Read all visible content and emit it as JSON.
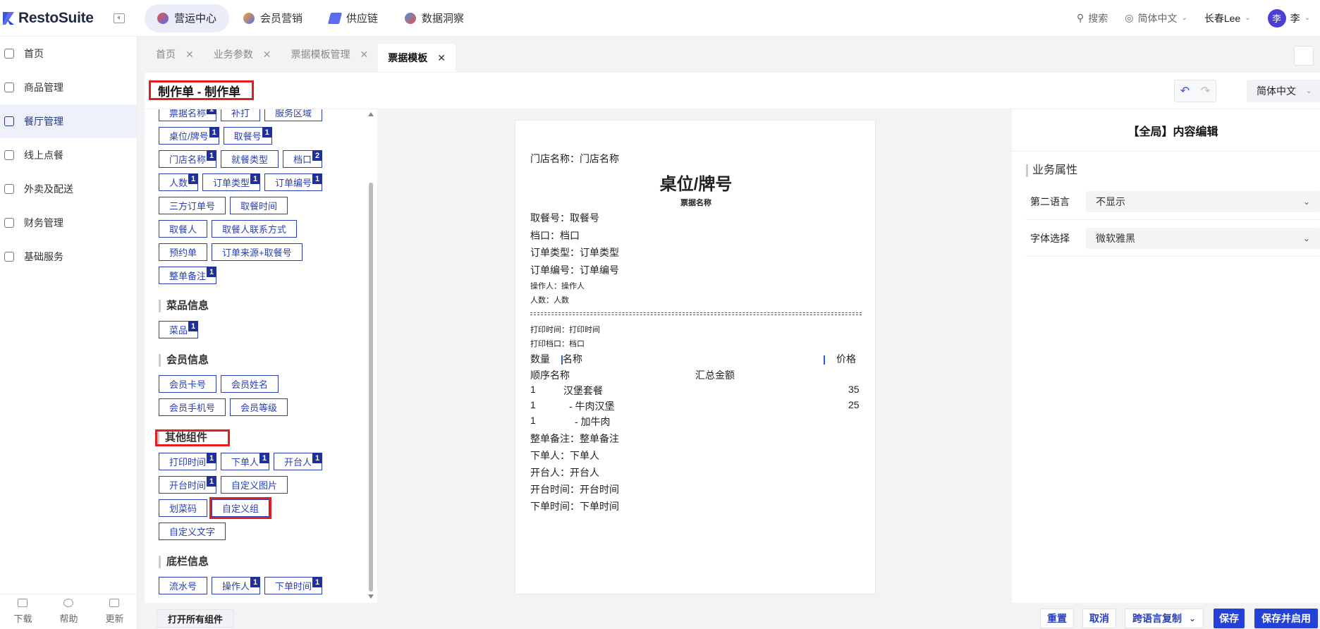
{
  "app": {
    "logo_text": "RestoSuite"
  },
  "nav": [
    {
      "label": "营运中心",
      "color": "#e9573f",
      "active": true
    },
    {
      "label": "会员营销",
      "color": "#f5a623",
      "active": false
    },
    {
      "label": "供应链",
      "color": "#5b6cf0",
      "active": false
    },
    {
      "label": "数据洞察",
      "color": "#4a90e2",
      "active": false
    }
  ],
  "topright": {
    "search": "搜索",
    "language": "简体中文",
    "store": "长春Lee",
    "avatar_char": "李",
    "user": "李"
  },
  "sidebar": {
    "items": [
      {
        "label": "首页"
      },
      {
        "label": "商品管理"
      },
      {
        "label": "餐厅管理",
        "active": true
      },
      {
        "label": "线上点餐"
      },
      {
        "label": "外卖及配送"
      },
      {
        "label": "财务管理"
      },
      {
        "label": "基础服务"
      }
    ],
    "bottom": [
      "下载",
      "帮助",
      "更新"
    ]
  },
  "tabs": [
    {
      "label": "首页"
    },
    {
      "label": "业务参数"
    },
    {
      "label": "票据模板管理"
    },
    {
      "label": "票据模板",
      "active": true
    }
  ],
  "header": {
    "title": "制作单 - 制作单",
    "language": "简体中文"
  },
  "components": {
    "rows_top": [
      [
        {
          "label": "票据名称",
          "badge": "1"
        },
        {
          "label": "补打"
        },
        {
          "label": "服务区域"
        }
      ],
      [
        {
          "label": "桌位/牌号",
          "badge": "1"
        },
        {
          "label": "取餐号",
          "badge": "1"
        }
      ],
      [
        {
          "label": "门店名称",
          "badge": "1"
        },
        {
          "label": "就餐类型"
        },
        {
          "label": "档口",
          "badge": "2"
        }
      ],
      [
        {
          "label": "人数",
          "badge": "1"
        },
        {
          "label": "订单类型",
          "badge": "1"
        },
        {
          "label": "订单编号",
          "badge": "1"
        }
      ],
      [
        {
          "label": "三方订单号"
        },
        {
          "label": "取餐时间"
        }
      ],
      [
        {
          "label": "取餐人"
        },
        {
          "label": "取餐人联系方式"
        }
      ],
      [
        {
          "label": "预约单"
        },
        {
          "label": "订单来源+取餐号"
        }
      ],
      [
        {
          "label": "整单备注",
          "badge": "1"
        }
      ]
    ],
    "dish_title": "菜品信息",
    "dish_rows": [
      [
        {
          "label": "菜品",
          "badge": "1"
        }
      ]
    ],
    "member_title": "会员信息",
    "member_rows": [
      [
        {
          "label": "会员卡号"
        },
        {
          "label": "会员姓名"
        }
      ],
      [
        {
          "label": "会员手机号"
        },
        {
          "label": "会员等级"
        }
      ]
    ],
    "other_title": "其他组件",
    "other_rows": [
      [
        {
          "label": "打印时间",
          "badge": "1"
        },
        {
          "label": "下单人",
          "badge": "1"
        },
        {
          "label": "开台人",
          "badge": "1"
        }
      ],
      [
        {
          "label": "开台时间",
          "badge": "1"
        },
        {
          "label": "自定义图片"
        }
      ],
      [
        {
          "label": "划菜码"
        },
        {
          "label": "自定义组",
          "highlight": true
        }
      ],
      [
        {
          "label": "自定义文字"
        }
      ]
    ],
    "footer_title": "底栏信息",
    "footer_rows": [
      [
        {
          "label": "流水号"
        },
        {
          "label": "操作人",
          "badge": "1"
        },
        {
          "label": "下单时间",
          "badge": "1"
        }
      ]
    ],
    "open_all": "打开所有组件"
  },
  "receipt": {
    "store": "门店名称：门店名称",
    "table": "桌位/牌号",
    "ticket_name": "票据名称",
    "pickup": "取餐号：取餐号",
    "stall": "档口：档口",
    "order_type": "订单类型：订单类型",
    "order_no": "订单编号：订单编号",
    "operator": "操作人：操作人",
    "people": "人数：人数",
    "print_time": "打印时间：打印时间",
    "print_stall": "打印档口：档口",
    "col_qty": "数量",
    "col_name": "名称",
    "col_price": "价格",
    "sub_left": "顺序名称",
    "sub_mid": "汇总金额",
    "items": [
      {
        "qty": "1",
        "name": "汉堡套餐",
        "price": "35"
      },
      {
        "qty": "1",
        "name": "- 牛肉汉堡",
        "price": "25"
      },
      {
        "qty": "1",
        "name": "- 加牛肉",
        "price": ""
      }
    ],
    "remark": "整单备注：整单备注",
    "orderer": "下单人：下单人",
    "opener": "开台人：开台人",
    "open_time": "开台时间：开台时间",
    "order_time": "下单时间：下单时间"
  },
  "right": {
    "title": "【全局】内容编辑",
    "section": "业务属性",
    "second_lang_label": "第二语言",
    "second_lang_value": "不显示",
    "font_label": "字体选择",
    "font_value": "微软雅黑"
  },
  "buttons": {
    "reset": "重置",
    "cancel": "取消",
    "copy": "跨语言复制",
    "save": "保存",
    "save_enable": "保存并启用"
  }
}
